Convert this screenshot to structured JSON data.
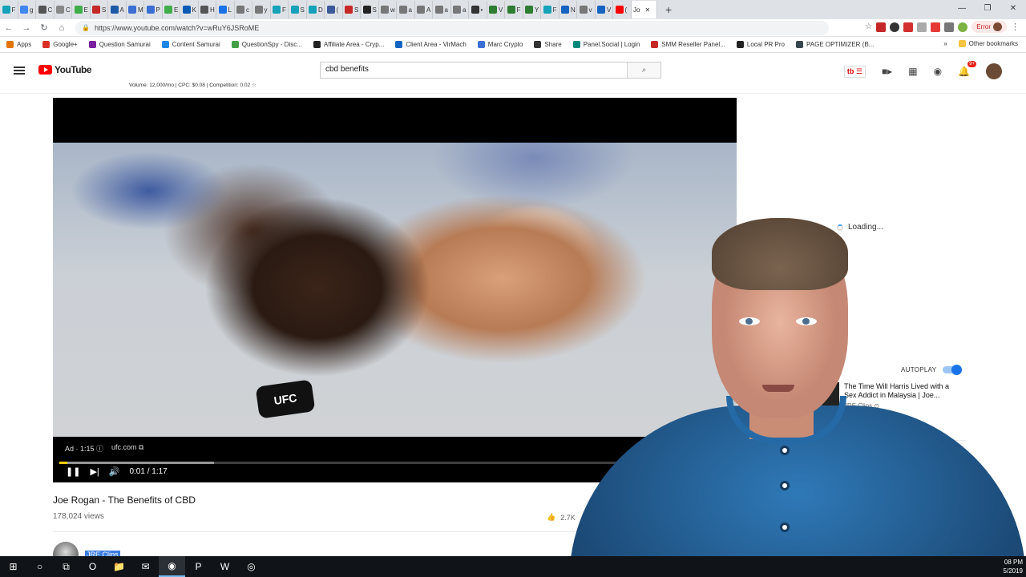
{
  "browser": {
    "tabs": [
      {
        "label": "F",
        "color": "#16a2b8"
      },
      {
        "label": "g",
        "color": "#4285f4"
      },
      {
        "label": "C",
        "color": "#555555"
      },
      {
        "label": "C",
        "color": "#888888"
      },
      {
        "label": "E",
        "color": "#3fae49"
      },
      {
        "label": "S",
        "color": "#c62828"
      },
      {
        "label": "A",
        "color": "#1e5aa8"
      },
      {
        "label": "M",
        "color": "#3b6fd4"
      },
      {
        "label": "P",
        "color": "#3b6fd4"
      },
      {
        "label": "E",
        "color": "#3fae49"
      },
      {
        "label": "K",
        "color": "#0b5bb5"
      },
      {
        "label": "H",
        "color": "#555555"
      },
      {
        "label": "L",
        "color": "#1a73e8"
      },
      {
        "label": "c",
        "color": "#777777"
      },
      {
        "label": "y",
        "color": "#777777"
      },
      {
        "label": "F",
        "color": "#16a2b8"
      },
      {
        "label": "S",
        "color": "#16a2b8"
      },
      {
        "label": "D",
        "color": "#16a2b8"
      },
      {
        "label": "(",
        "color": "#3b5998"
      },
      {
        "label": "S",
        "color": "#c62828"
      },
      {
        "label": "S",
        "color": "#222222"
      },
      {
        "label": "w",
        "color": "#777777"
      },
      {
        "label": "a",
        "color": "#777777"
      },
      {
        "label": "A",
        "color": "#777777"
      },
      {
        "label": "a",
        "color": "#777777"
      },
      {
        "label": "a",
        "color": "#777777"
      },
      {
        "label": "•",
        "color": "#333333"
      },
      {
        "label": "V",
        "color": "#2e7d32"
      },
      {
        "label": "F",
        "color": "#2e7d32"
      },
      {
        "label": "Y",
        "color": "#2e7d32"
      },
      {
        "label": "F",
        "color": "#16a2b8"
      },
      {
        "label": "N",
        "color": "#1565c0"
      },
      {
        "label": "v",
        "color": "#777777"
      },
      {
        "label": "V",
        "color": "#1565c0"
      },
      {
        "label": "(",
        "color": "#ff0000"
      }
    ],
    "active_tab_label": "Jo",
    "new_tab_symbol": "+",
    "window_controls": [
      "—",
      "❐",
      "✕"
    ],
    "url": "https://www.youtube.com/watch?v=wRuY6JSRoME",
    "error_label": "Error",
    "bookmarks": [
      {
        "label": "Apps",
        "color": "#e37400"
      },
      {
        "label": "Google+",
        "color": "#d93025"
      },
      {
        "label": "Question Samurai",
        "color": "#7b1fa2"
      },
      {
        "label": "Content Samurai",
        "color": "#1e88e5"
      },
      {
        "label": "QuestionSpy - Disc...",
        "color": "#43a047"
      },
      {
        "label": "Affiliate Area - Cryp...",
        "color": "#222222"
      },
      {
        "label": "Client Area - VirMach",
        "color": "#1565c0"
      },
      {
        "label": "Marc Crypto",
        "color": "#3b6fd4"
      },
      {
        "label": "Share",
        "color": "#333333"
      },
      {
        "label": "Panel.Social | Login",
        "color": "#00897b"
      },
      {
        "label": "SMM Reseller Panel...",
        "color": "#c62828"
      },
      {
        "label": "Local PR Pro",
        "color": "#222222"
      },
      {
        "label": "PAGE OPTIMIZER (B...",
        "color": "#37474f"
      }
    ],
    "bookmarks_overflow": "»",
    "other_bookmarks": "Other bookmarks"
  },
  "youtube": {
    "logo_text": "YouTube",
    "search_value": "cbd benefits",
    "keyword_stats": "Volume: 12,000/mo | CPC: $0.08 | Competition: 0.02 ☆",
    "notification_count": "9+",
    "tubebuddy_label": "tb ☰",
    "player": {
      "glove_text": "UFC",
      "ad_label": "Ad · 1:15 ⓘ",
      "ad_domain": "ufc.com ⧉",
      "time": "0:01 / 1:17",
      "progress_percent": 1.2,
      "buffered_percent": 23
    },
    "video_title": "Joe Rogan - The Benefits of CBD",
    "views": "178,024 views",
    "likes": "2.7K",
    "channel_name": "JRE Clips",
    "loading_text": "Loading...",
    "autoplay_label": "AUTOPLAY",
    "next_video": {
      "title": "The Time Will Harris Lived with a Sex Addict in Malaysia | Joe...",
      "channel": "JRE Clips ⊙"
    }
  },
  "taskbar": {
    "items": [
      "⊞",
      "○",
      "⧉",
      "O",
      "📁",
      "✉",
      "◉",
      "P",
      "W",
      "◎"
    ],
    "clock_time": "08 PM",
    "clock_date": "5/2019"
  }
}
